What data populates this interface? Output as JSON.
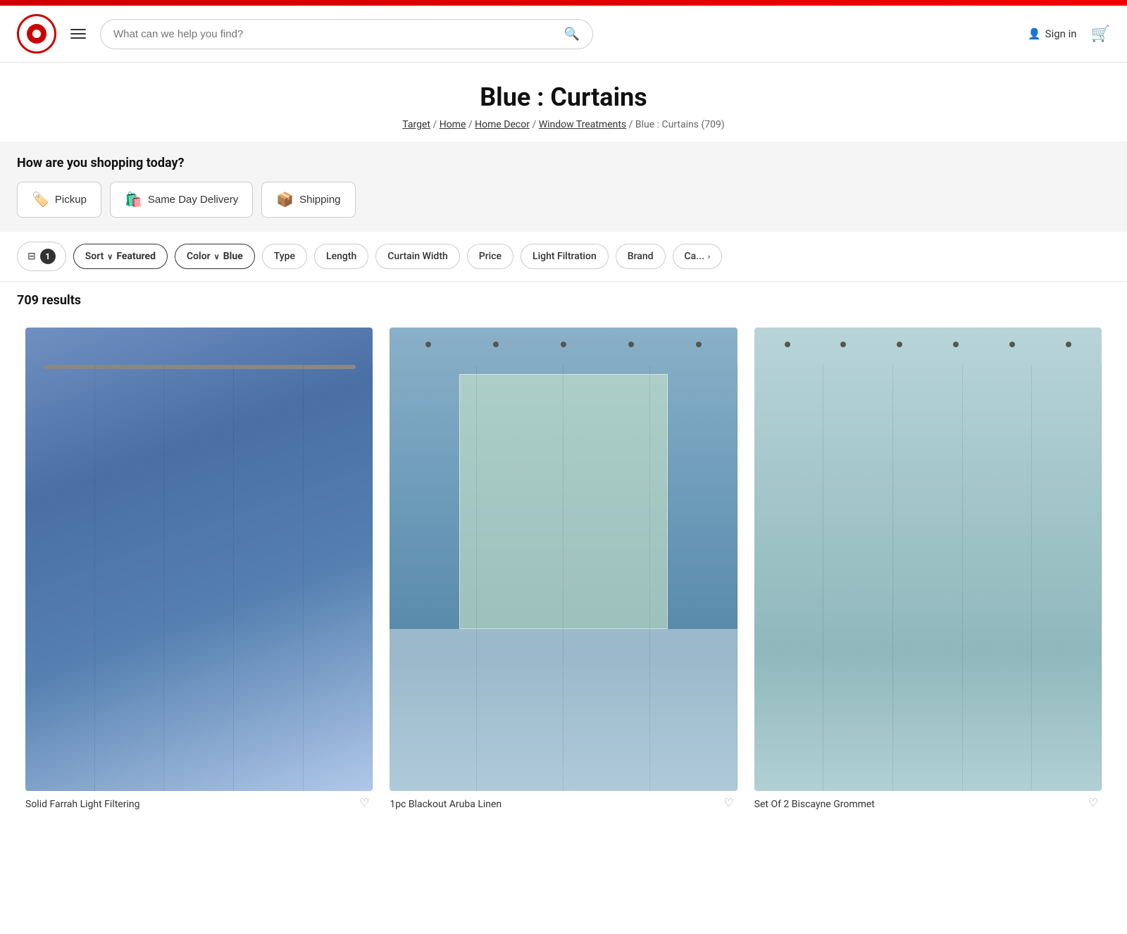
{
  "topBar": {},
  "header": {
    "logo_alt": "Target Logo",
    "search_placeholder": "What can we help you find?",
    "sign_in_label": "Sign in",
    "hamburger_label": "Menu"
  },
  "page": {
    "title": "Blue : Curtains",
    "breadcrumb": {
      "items": [
        "Target",
        "Home",
        "Home Decor",
        "Window Treatments"
      ],
      "current": "Blue : Curtains (709)"
    }
  },
  "shopping_section": {
    "question": "How are you shopping today?",
    "buttons": [
      {
        "label": "Pickup",
        "icon": "🏷️"
      },
      {
        "label": "Same Day Delivery",
        "icon": "🛍️"
      },
      {
        "label": "Shipping",
        "icon": "📦"
      }
    ]
  },
  "filters": {
    "active_count": "1",
    "chips": [
      {
        "label": "Sort",
        "sub": "Featured",
        "active": true,
        "has_chevron": true
      },
      {
        "label": "Color",
        "sub": "Blue",
        "active": true,
        "has_chevron": true
      },
      {
        "label": "Type",
        "active": false,
        "has_chevron": false
      },
      {
        "label": "Length",
        "active": false,
        "has_chevron": false
      },
      {
        "label": "Curtain Width",
        "active": false,
        "has_chevron": false
      },
      {
        "label": "Price",
        "active": false,
        "has_chevron": false
      },
      {
        "label": "Light Filtration",
        "active": false,
        "has_chevron": false
      },
      {
        "label": "Brand",
        "active": false,
        "has_chevron": false
      },
      {
        "label": "Ca...",
        "active": false,
        "has_chevron": true
      }
    ]
  },
  "results": {
    "count": "709 results"
  },
  "products": [
    {
      "name": "Solid Farrah Light Filtering",
      "style": "curtain-1",
      "has_rod": true,
      "rod_type": "wall"
    },
    {
      "name": "1pc Blackout Aruba Linen",
      "style": "curtain-2",
      "has_rod": true,
      "rod_type": "top"
    },
    {
      "name": "Set Of 2 Biscayne Grommet",
      "style": "curtain-3",
      "has_rod": true,
      "rod_type": "grommets"
    }
  ],
  "icons": {
    "search": "🔍",
    "user": "👤",
    "cart": "🛒",
    "heart": "♡",
    "chevron_down": "∨",
    "chevron_right": "›",
    "filter": "⊟"
  }
}
